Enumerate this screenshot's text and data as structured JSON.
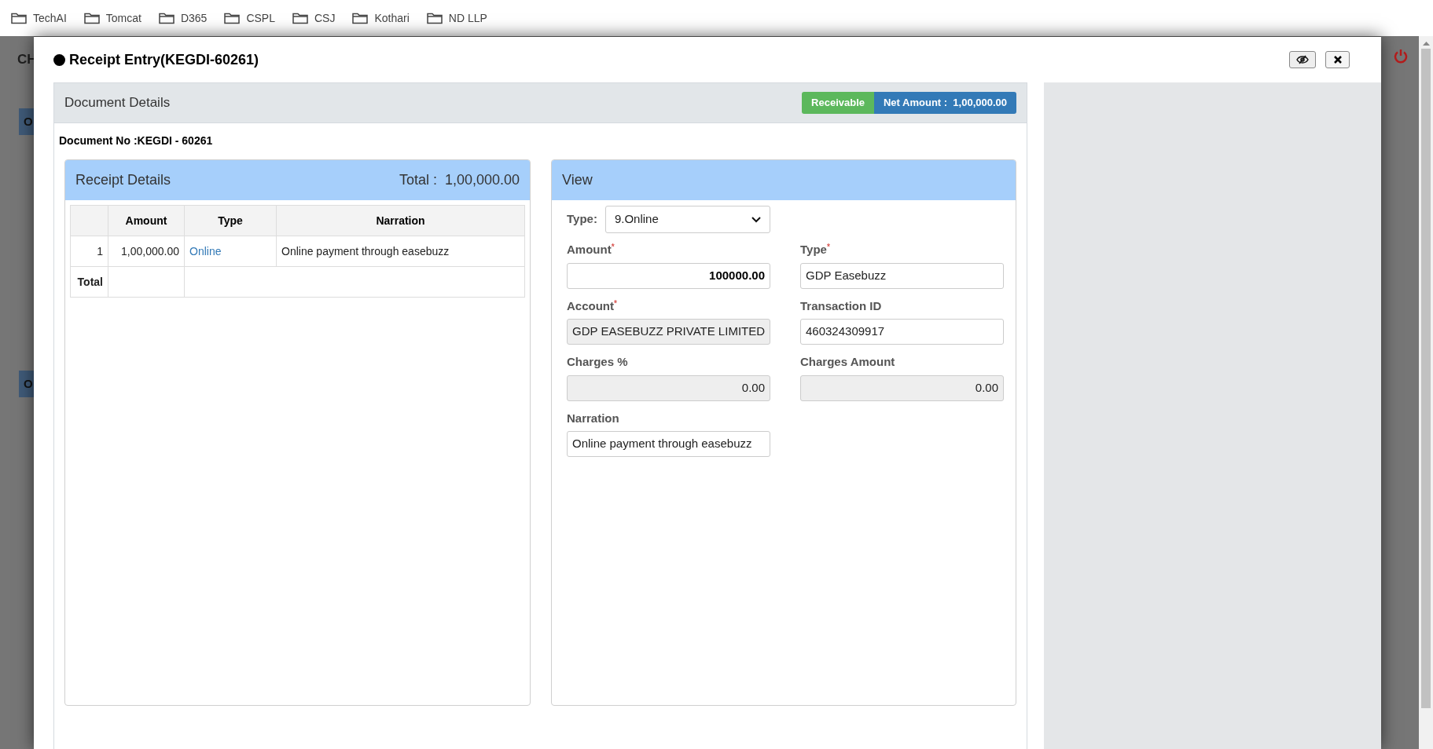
{
  "bookmarks": [
    "TechAI",
    "Tomcat",
    "D365",
    "CSPL",
    "CSJ",
    "Kothari",
    "ND LLP"
  ],
  "background": {
    "header_fragment": "CH",
    "section_fragments": [
      "O",
      "O"
    ]
  },
  "modal": {
    "title": "Receipt Entry(KEGDI-60261)"
  },
  "document_panel": {
    "title": "Document Details",
    "status_badge": "Receivable",
    "net_amount_badge": "Net Amount :  1,00,000.00",
    "document_no": "Document No :KEGDI - 60261"
  },
  "receipt_panel": {
    "title": "Receipt Details",
    "total": "Total :  1,00,000.00",
    "columns": [
      "",
      "Amount",
      "Type",
      "Narration"
    ],
    "rows": [
      {
        "index": "1",
        "amount": "1,00,000.00",
        "type": "Online",
        "narration": "Online payment through easebuzz"
      }
    ],
    "total_row_label": "Total"
  },
  "view_panel": {
    "title": "View",
    "type_label": "Type:",
    "type_value": "9.Online",
    "fields": [
      {
        "label": "Amount",
        "required_mark": "*",
        "value": "100000.00",
        "kind": "number",
        "readonly": false,
        "bold": true
      },
      {
        "label": "Type",
        "required_mark": "*",
        "value": "GDP Easebuzz",
        "kind": "text",
        "readonly": false,
        "bold": false
      },
      {
        "label": "Account",
        "required_mark": "*",
        "value": "GDP EASEBUZZ PRIVATE LIMITED",
        "kind": "text",
        "readonly": true,
        "bold": false
      },
      {
        "label": "Transaction ID",
        "value": "460324309917",
        "kind": "text",
        "readonly": false,
        "bold": false
      },
      {
        "label": "Charges %",
        "value": "0.00",
        "kind": "number",
        "readonly": true,
        "bold": false
      },
      {
        "label": "Charges Amount",
        "value": "0.00",
        "kind": "number",
        "readonly": true,
        "bold": false
      },
      {
        "label": "Narration",
        "value": "Online payment through easebuzz",
        "kind": "text",
        "readonly": false,
        "bold": false
      }
    ]
  }
}
